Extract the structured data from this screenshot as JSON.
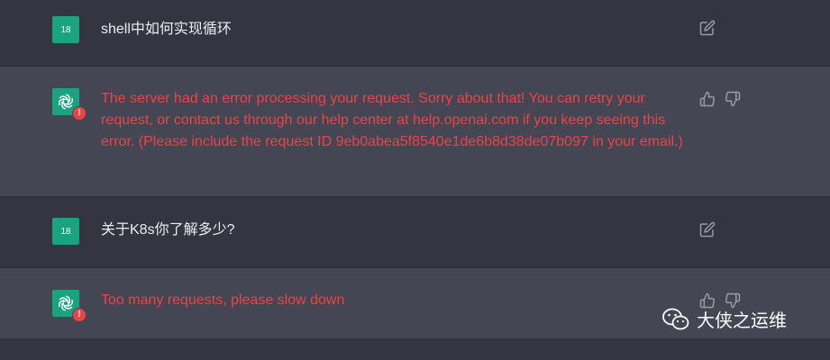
{
  "conversation": [
    {
      "role": "user",
      "avatar_text": "18",
      "text": "shell中如何实现循环"
    },
    {
      "role": "assistant",
      "error_badge": "!",
      "text": "The server had an error processing your request. Sorry about that! You can retry your request, or contact us through our help center at help.openai.com if you keep seeing this error. (Please include the request ID 9eb0abea5f8540e1de6b8d38de07b097 in your email.)"
    },
    {
      "role": "user",
      "avatar_text": "18",
      "text": "关于K8s你了解多少?"
    },
    {
      "role": "assistant",
      "error_badge": "!",
      "text": "Too many requests, please slow down"
    }
  ],
  "watermark": {
    "text": "大侠之运维",
    "icon": "wechat-icon"
  },
  "icons": {
    "edit": "edit-icon",
    "thumbs_up": "thumbs-up-icon",
    "thumbs_down": "thumbs-down-icon",
    "assistant": "openai-logo-icon"
  },
  "colors": {
    "bg_user": "#343541",
    "bg_assistant": "#444654",
    "user_avatar": "#19a37f",
    "error": "#ef4146",
    "text": "#ececf1"
  }
}
